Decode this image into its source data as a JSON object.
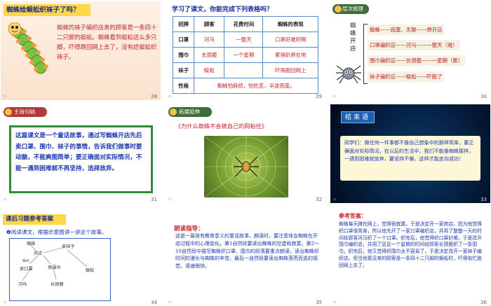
{
  "slides": {
    "s28": {
      "page": "28",
      "title": "蜘蛛给蜈蚣织袜子了吗？",
      "text": "蜘蛛的袜子编织店来的顾客是一条四十二只脚的蜈蚣。蜘蛛看到蜈蚣这么多只脚，吓得跑回网上去了，没有给蜈蚣织袜子。"
    },
    "s29": {
      "page": "29",
      "title": "学习了课文，你能完成下列表格吗？",
      "headers": [
        "招牌",
        "顾客",
        "花费时间",
        "蜘蛛的表现"
      ],
      "rows": [
        [
          "口罩",
          "河马",
          "一整天",
          "口罩好难织啊"
        ],
        [
          "围巾",
          "长颈鹿",
          "一个星期",
          "累得趴倒在地"
        ],
        [
          "袜子",
          "蜈蚣",
          "",
          "吓得跑回网上"
        ],
        [
          "性格",
          "蜘蛛怕麻烦，怕吃苦，半途而废。",
          "",
          ""
        ]
      ]
    },
    "s30": {
      "page": "30",
      "header": "层次梳理",
      "vtitle": "蜘蛛开店",
      "lines": [
        "蜘蛛——寂寞、无聊——想开店",
        "口罩编织店——河马——一整天（难）",
        "围巾编织店——长颈鹿——一星期（累）",
        "袜子编织店——蜈蚣——吓跑了"
      ]
    },
    "s31": {
      "page": "31",
      "header": "主旨归纳",
      "text": "这篇课文是一个童话故事，通过写蜘蛛开店先后卖口罩、围巾、袜子的事情，告诉我们做事时要动脑，不能爽图简单；要正确面对实际情况，不能一遇到困难就不再坚持，选择放弃。"
    },
    "s32": {
      "page": "32",
      "header": "拓展延伸",
      "title": "《为什么蜘蛛不会被自己的网粘住》"
    },
    "s33": {
      "page": "33",
      "title": "结束语",
      "text": "同学们：做任何一件事都不像自己想象中的那样简单，要正确面对实际情况。在以后的生活中，我们不能像蜘蛛那样，一遇到困难就放弃，要坚持不懈，这样才能走向成功！"
    },
    "s34": {
      "page": "34",
      "title": "课后习题参考答案",
      "subtitle": "❶阅读课文，根据示意图讲一讲这个故事。",
      "labels": [
        "蜘蛛",
        "开店",
        "卖袜子",
        "mo",
        "卖口罩",
        "卖围巾",
        "蜈蚣",
        "河马",
        "长颈鹿"
      ]
    },
    "s35": {
      "page": "35",
      "title": "朗读指导：",
      "text": "这是一篇很有教育意义的童话故事，朗读时，要注意体会蜘蛛在开店过程中的心理变化。第1自然段要读出蜘蛛的空虚和寂寞。第2～10自然段中描写蜘蛛织口罩、围巾的段落要重点朗读，读出蜘蛛织时间的漫长与蜘蛛的辛苦。最后一自然段要读出蜘蛛落荒而逃的感觉，语速稍快。"
    },
    "s36": {
      "page": "36",
      "title": "参考答案：",
      "text": "蜘蛛每天蹲在网上，觉得很寂寞，于是决定开一家商店。因为他觉得织口罩很简单，所以他先开了一家口罩编织店，并用了整整一天的时间给顾客河马织了一个口罩。织完后，他觉得织口罩好难，于是改开围巾编织店，并用了足足一个星期的时间给顾客长颈鹿织了一条围巾。织完后，他又觉得织围巾太不容易了，于是决定改开一家袜子编织店。但当他看见来的顾客是一条四十二只脚的蜈蚣时，吓得匆忙跑回网上去了。"
    }
  }
}
